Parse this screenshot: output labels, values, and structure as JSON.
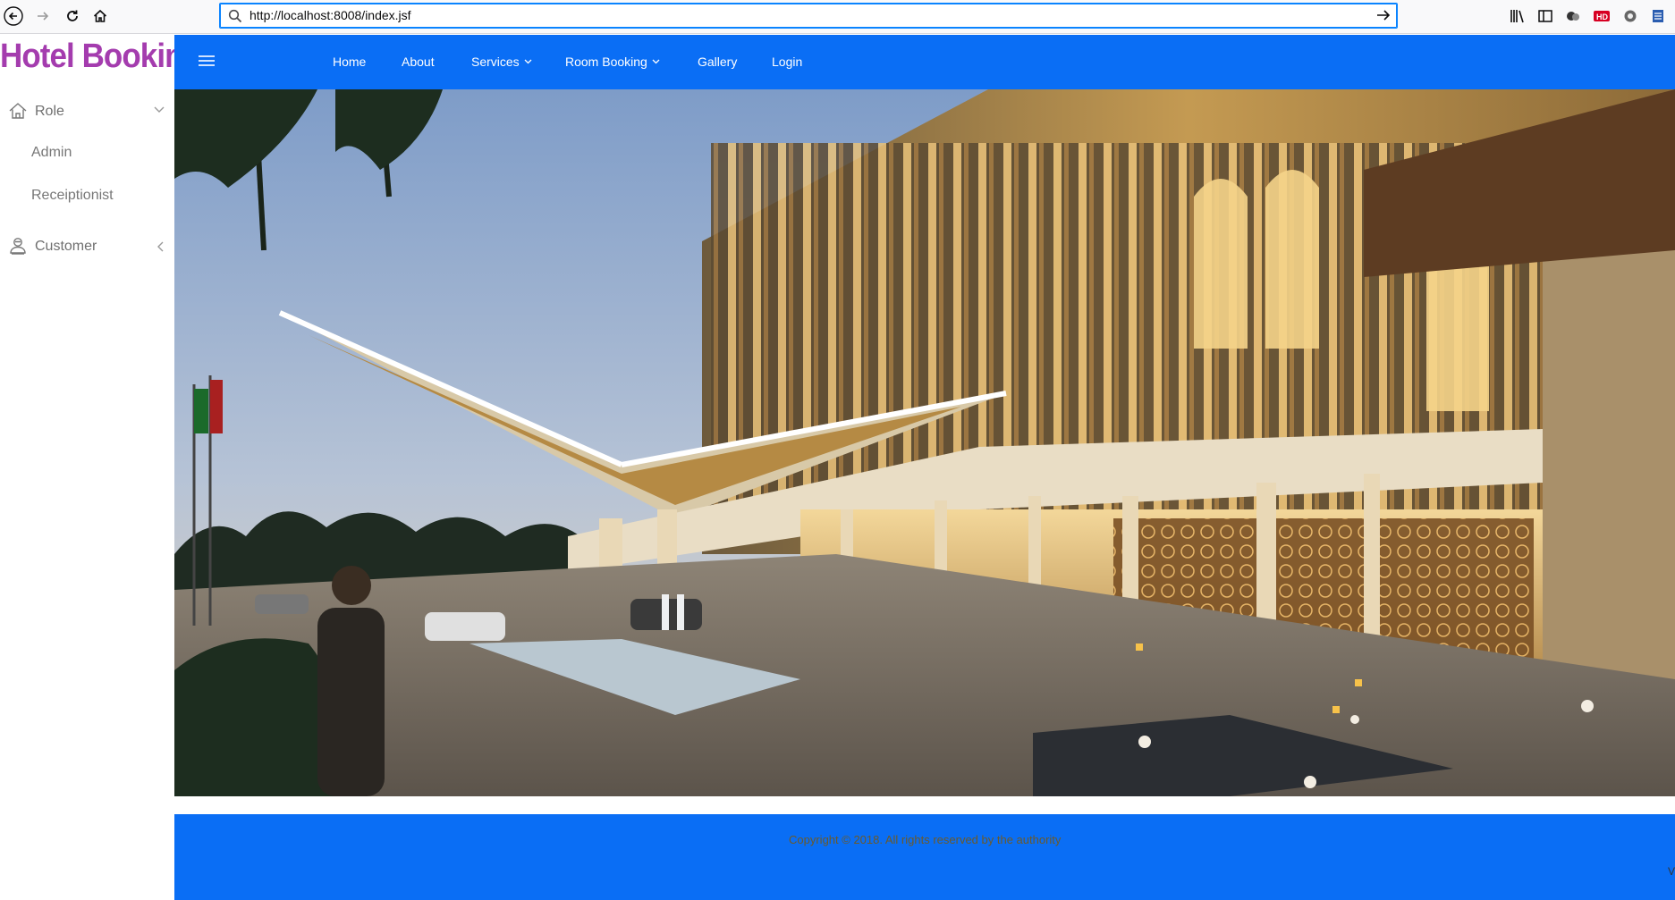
{
  "browser": {
    "url": "http://localhost:8008/index.jsf"
  },
  "brand": "Hotel Booking",
  "sidebar": {
    "items": [
      {
        "label": "Role",
        "icon": "home-icon",
        "expanded": true,
        "children": [
          {
            "label": "Admin"
          },
          {
            "label": "Receiptionist"
          }
        ]
      },
      {
        "label": "Customer",
        "icon": "user-icon",
        "expanded": false
      }
    ]
  },
  "nav": {
    "links": [
      {
        "label": "Home"
      },
      {
        "label": "About"
      },
      {
        "label": "Services",
        "dropdown": true
      },
      {
        "label": "Room Booking",
        "dropdown": true
      },
      {
        "label": "Gallery"
      },
      {
        "label": "Login"
      }
    ]
  },
  "hero": {
    "image": "hotel-exterior-at-dusk"
  },
  "footer": {
    "copyright": "Copyright © 2018. All rights reserved by the authority",
    "edge_text": "V"
  },
  "colors": {
    "accent": "#0a6ef5",
    "brand": "#a43cae",
    "sidebar_text": "#6f6f6f"
  }
}
